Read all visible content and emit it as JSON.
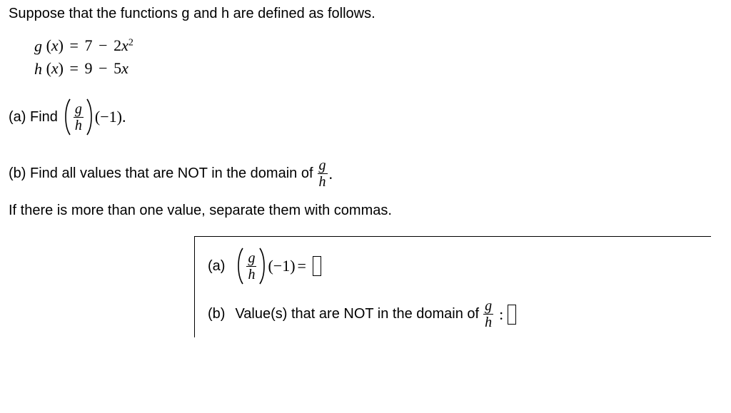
{
  "intro": "Suppose that the functions g and h are defined as follows.",
  "defs": {
    "g": {
      "fn": "g",
      "var": "x",
      "rhs_a": "7",
      "rhs_op": "−",
      "rhs_b": "2",
      "rhs_var": "x",
      "rhs_pow": "2"
    },
    "h": {
      "fn": "h",
      "var": "x",
      "rhs_a": "9",
      "rhs_op": "−",
      "rhs_b": "5",
      "rhs_var": "x"
    }
  },
  "partA": {
    "label": "(a) Find",
    "frac_num": "g",
    "frac_den": "h",
    "arg_sign": "−",
    "arg_val": "1",
    "period": "."
  },
  "partB": {
    "text_prefix": "(b) Find all values that are NOT in the domain of ",
    "frac_num": "g",
    "frac_den": "h",
    "period": "."
  },
  "follow": "If there is more than one value, separate them with commas.",
  "answer": {
    "a_label": "(a)",
    "a_frac_num": "g",
    "a_frac_den": "h",
    "a_arg_sign": "−",
    "a_arg_val": "1",
    "a_eq": "=",
    "b_label": "(b)",
    "b_text": "Value(s) that are NOT in the domain of ",
    "b_frac_num": "g",
    "b_frac_den": "h",
    "b_colon": ":"
  }
}
